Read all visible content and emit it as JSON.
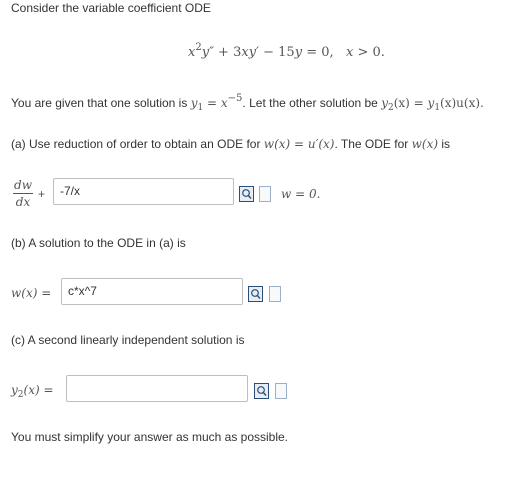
{
  "intro": "Consider the variable coefficient ODE",
  "ode": {
    "x": "x",
    "sq": "2",
    "y2": "y″",
    "plus1": " + 3",
    "x2": "x",
    "y1": "y′",
    "minus": " − 15",
    "y": "y",
    "eq": " = 0,",
    "cond_x": "x",
    "cond": " > 0."
  },
  "given": {
    "prefix": "You are given that one solution is ",
    "y1": "y",
    "y1_sub": "1",
    "eq": " = ",
    "x": "x",
    "exp": "−5",
    "middle": ". Let the other solution be ",
    "y2": "y",
    "y2_sub": "2",
    "y2_arg": "(x) = ",
    "y1b": "y",
    "y1b_sub": "1",
    "y1b_arg": "(x)u(x)."
  },
  "part_a": {
    "label_prefix": "(a) Use reduction of order to obtain an ODE for ",
    "label_math": "w(x) = u′(x)",
    "label_suffix": ". The ODE for ",
    "label_math2": "w(x)",
    "label_end": " is",
    "frac_num": "dw",
    "frac_den": "dx",
    "plus": "+",
    "input_value": "-7/x",
    "after": "w = 0."
  },
  "part_b": {
    "label": "(b) A solution to the ODE in (a) is",
    "lhs": "w(x) =",
    "input_value": "c*x^7"
  },
  "part_c": {
    "label": "(c) A second linearly independent solution is",
    "lhs_y": "y",
    "lhs_sub": "2",
    "lhs_rest": "(x) =",
    "input_value": ""
  },
  "footer": "You must simplify your answer as much as possible."
}
